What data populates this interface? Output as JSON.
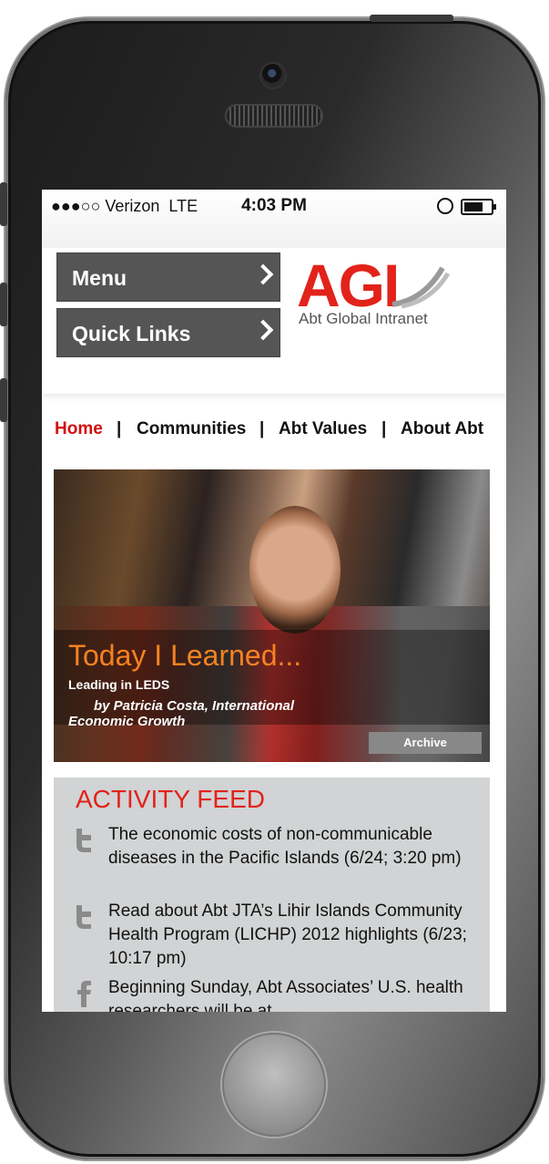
{
  "status_bar": {
    "carrier": "●●●○○ Verizon",
    "network": "LTE",
    "time": "4:03 PM"
  },
  "header": {
    "menu_label": "Menu",
    "quick_links_label": "Quick Links",
    "logo_text": "AGI",
    "logo_sub": "Abt Global Intranet"
  },
  "nav": {
    "items": [
      "Home",
      "Communities",
      "Abt Values",
      "About Abt"
    ],
    "separator": "|"
  },
  "hero": {
    "title": "Today I Learned...",
    "subtitle": "Leading in LEDS",
    "byline_1": "by Patricia Costa, International",
    "byline_2": "Economic Growth",
    "archive_label": "Archive"
  },
  "activity_feed": {
    "title": "ACTIVITY FEED",
    "items": [
      {
        "icon": "twitter-icon",
        "text": "The economic costs of non-communicable diseases in the Pacific Islands (6/24; 3:20 pm)"
      },
      {
        "icon": "twitter-icon",
        "text": "Read about Abt JTA’s Lihir Islands Community Health Program (LICHP) 2012 highlights (6/23; 10:17 pm)"
      },
      {
        "icon": "facebook-icon",
        "text": "Beginning Sunday, Abt Associates’ U.S. health researchers will be at"
      }
    ]
  },
  "colors": {
    "accent_red": "#e2231a",
    "nav_active": "#d20e0e",
    "button_gray": "#555555",
    "hero_orange": "#f58220",
    "feed_bg": "#d1d3d4"
  }
}
